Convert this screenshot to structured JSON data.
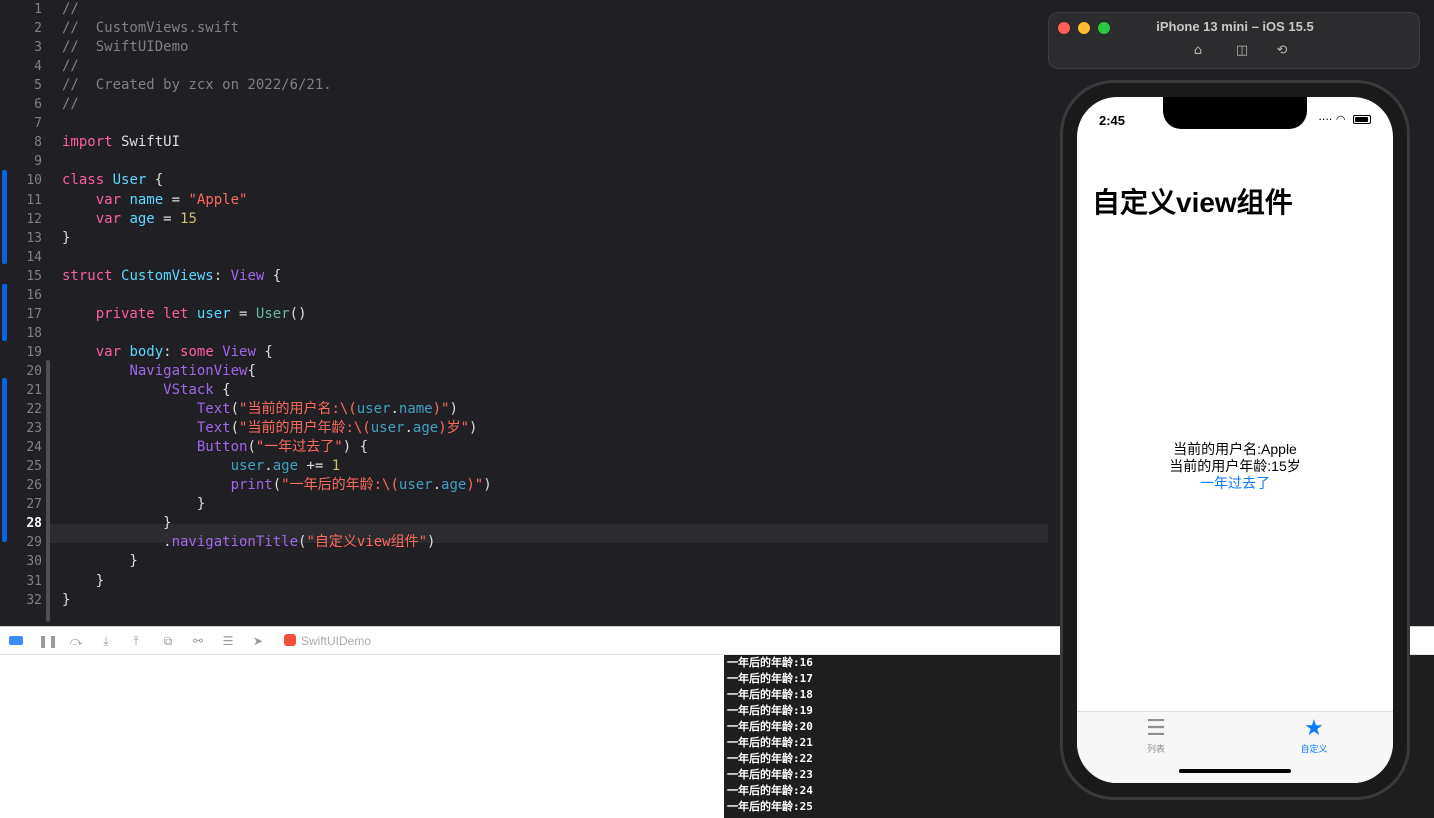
{
  "editor": {
    "lines": [
      {
        "n": "1",
        "tokens": [
          {
            "t": "//",
            "c": "comment"
          }
        ]
      },
      {
        "n": "2",
        "tokens": [
          {
            "t": "//  CustomViews.swift",
            "c": "comment"
          }
        ]
      },
      {
        "n": "3",
        "tokens": [
          {
            "t": "//  SwiftUIDemo",
            "c": "comment"
          }
        ]
      },
      {
        "n": "4",
        "tokens": [
          {
            "t": "//",
            "c": "comment"
          }
        ]
      },
      {
        "n": "5",
        "tokens": [
          {
            "t": "//  Created by zcx on 2022/6/21.",
            "c": "comment"
          }
        ]
      },
      {
        "n": "6",
        "tokens": [
          {
            "t": "//",
            "c": "comment"
          }
        ]
      },
      {
        "n": "7",
        "tokens": []
      },
      {
        "n": "8",
        "tokens": [
          {
            "t": "import",
            "c": "kw"
          },
          {
            "t": " SwiftUI",
            "c": "plain"
          }
        ]
      },
      {
        "n": "9",
        "tokens": []
      },
      {
        "n": "10",
        "tokens": [
          {
            "t": "class",
            "c": "kw"
          },
          {
            "t": " ",
            "c": "plain"
          },
          {
            "t": "User",
            "c": "type"
          },
          {
            "t": " {",
            "c": "plain"
          }
        ]
      },
      {
        "n": "11",
        "tokens": [
          {
            "t": "    ",
            "c": "plain"
          },
          {
            "t": "var",
            "c": "kw"
          },
          {
            "t": " ",
            "c": "plain"
          },
          {
            "t": "name",
            "c": "type"
          },
          {
            "t": " = ",
            "c": "plain"
          },
          {
            "t": "\"Apple\"",
            "c": "str"
          }
        ]
      },
      {
        "n": "12",
        "tokens": [
          {
            "t": "    ",
            "c": "plain"
          },
          {
            "t": "var",
            "c": "kw"
          },
          {
            "t": " ",
            "c": "plain"
          },
          {
            "t": "age",
            "c": "type"
          },
          {
            "t": " = ",
            "c": "plain"
          },
          {
            "t": "15",
            "c": "num"
          }
        ]
      },
      {
        "n": "13",
        "tokens": [
          {
            "t": "}",
            "c": "plain"
          }
        ]
      },
      {
        "n": "14",
        "tokens": []
      },
      {
        "n": "15",
        "tokens": [
          {
            "t": "struct",
            "c": "kw"
          },
          {
            "t": " ",
            "c": "plain"
          },
          {
            "t": "CustomViews",
            "c": "type"
          },
          {
            "t": ": ",
            "c": "plain"
          },
          {
            "t": "View",
            "c": "sys"
          },
          {
            "t": " {",
            "c": "plain"
          }
        ]
      },
      {
        "n": "16",
        "tokens": []
      },
      {
        "n": "17",
        "tokens": [
          {
            "t": "    ",
            "c": "plain"
          },
          {
            "t": "private",
            "c": "kw"
          },
          {
            "t": " ",
            "c": "plain"
          },
          {
            "t": "let",
            "c": "kw"
          },
          {
            "t": " ",
            "c": "plain"
          },
          {
            "t": "user",
            "c": "type"
          },
          {
            "t": " = ",
            "c": "plain"
          },
          {
            "t": "User",
            "c": "fn"
          },
          {
            "t": "()",
            "c": "plain"
          }
        ]
      },
      {
        "n": "18",
        "tokens": []
      },
      {
        "n": "19",
        "tokens": [
          {
            "t": "    ",
            "c": "plain"
          },
          {
            "t": "var",
            "c": "kw"
          },
          {
            "t": " ",
            "c": "plain"
          },
          {
            "t": "body",
            "c": "type"
          },
          {
            "t": ": ",
            "c": "plain"
          },
          {
            "t": "some",
            "c": "kw"
          },
          {
            "t": " ",
            "c": "plain"
          },
          {
            "t": "View",
            "c": "sys"
          },
          {
            "t": " {",
            "c": "plain"
          }
        ]
      },
      {
        "n": "20",
        "tokens": [
          {
            "t": "        ",
            "c": "plain"
          },
          {
            "t": "NavigationView",
            "c": "sys"
          },
          {
            "t": "{",
            "c": "plain"
          }
        ]
      },
      {
        "n": "21",
        "tokens": [
          {
            "t": "            ",
            "c": "plain"
          },
          {
            "t": "VStack",
            "c": "sys"
          },
          {
            "t": " {",
            "c": "plain"
          }
        ]
      },
      {
        "n": "22",
        "tokens": [
          {
            "t": "                ",
            "c": "plain"
          },
          {
            "t": "Text",
            "c": "sys"
          },
          {
            "t": "(",
            "c": "plain"
          },
          {
            "t": "\"当前的用户名:\\(",
            "c": "str"
          },
          {
            "t": "user",
            "c": "prop"
          },
          {
            "t": ".",
            "c": "plain"
          },
          {
            "t": "name",
            "c": "prop"
          },
          {
            "t": ")\"",
            "c": "str"
          },
          {
            "t": ")",
            "c": "plain"
          }
        ]
      },
      {
        "n": "23",
        "tokens": [
          {
            "t": "                ",
            "c": "plain"
          },
          {
            "t": "Text",
            "c": "sys"
          },
          {
            "t": "(",
            "c": "plain"
          },
          {
            "t": "\"当前的用户年龄:\\(",
            "c": "str"
          },
          {
            "t": "user",
            "c": "prop"
          },
          {
            "t": ".",
            "c": "plain"
          },
          {
            "t": "age",
            "c": "prop"
          },
          {
            "t": ")岁\"",
            "c": "str"
          },
          {
            "t": ")",
            "c": "plain"
          }
        ]
      },
      {
        "n": "24",
        "tokens": [
          {
            "t": "                ",
            "c": "plain"
          },
          {
            "t": "Button",
            "c": "sys"
          },
          {
            "t": "(",
            "c": "plain"
          },
          {
            "t": "\"一年过去了\"",
            "c": "str"
          },
          {
            "t": ") {",
            "c": "plain"
          }
        ]
      },
      {
        "n": "25",
        "tokens": [
          {
            "t": "                    ",
            "c": "plain"
          },
          {
            "t": "user",
            "c": "prop"
          },
          {
            "t": ".",
            "c": "plain"
          },
          {
            "t": "age",
            "c": "prop"
          },
          {
            "t": " += ",
            "c": "plain"
          },
          {
            "t": "1",
            "c": "num"
          }
        ]
      },
      {
        "n": "26",
        "tokens": [
          {
            "t": "                    ",
            "c": "plain"
          },
          {
            "t": "print",
            "c": "sys"
          },
          {
            "t": "(",
            "c": "plain"
          },
          {
            "t": "\"一年后的年龄:\\(",
            "c": "str"
          },
          {
            "t": "user",
            "c": "prop"
          },
          {
            "t": ".",
            "c": "plain"
          },
          {
            "t": "age",
            "c": "prop"
          },
          {
            "t": ")\"",
            "c": "str"
          },
          {
            "t": ")",
            "c": "plain"
          }
        ]
      },
      {
        "n": "27",
        "tokens": [
          {
            "t": "                }",
            "c": "plain"
          }
        ]
      },
      {
        "n": "28",
        "tokens": [
          {
            "t": "            }",
            "c": "plain"
          }
        ]
      },
      {
        "n": "29",
        "tokens": [
          {
            "t": "            .",
            "c": "plain"
          },
          {
            "t": "navigationTitle",
            "c": "sys"
          },
          {
            "t": "(",
            "c": "plain"
          },
          {
            "t": "\"自定义view组件\"",
            "c": "str"
          },
          {
            "t": ")",
            "c": "plain"
          }
        ]
      },
      {
        "n": "30",
        "tokens": [
          {
            "t": "        }",
            "c": "plain"
          }
        ]
      },
      {
        "n": "31",
        "tokens": [
          {
            "t": "    }",
            "c": "plain"
          }
        ]
      },
      {
        "n": "32",
        "tokens": [
          {
            "t": "}",
            "c": "plain"
          }
        ]
      }
    ],
    "current_line": "28"
  },
  "debug_bar": {
    "scheme_label": "SwiftUIDemo",
    "icons": [
      "breakpoint-toggle-icon",
      "pause-icon",
      "step-over-icon",
      "step-into-icon",
      "step-out-icon",
      "view-hierarchy-icon",
      "memory-graph-icon",
      "environment-overrides-icon",
      "location-icon"
    ]
  },
  "console": {
    "lines": [
      "一年后的年龄:16",
      "一年后的年龄:17",
      "一年后的年龄:18",
      "一年后的年龄:19",
      "一年后的年龄:20",
      "一年后的年龄:21",
      "一年后的年龄:22",
      "一年后的年龄:23",
      "一年后的年龄:24",
      "一年后的年龄:25"
    ]
  },
  "simulator": {
    "title": "iPhone 13 mini – iOS 15.5",
    "toolbar_icons": [
      "home-icon",
      "screenshot-icon",
      "rotate-icon"
    ],
    "status_time": "2:45",
    "nav_title": "自定义view组件",
    "user_name_text": "当前的用户名:Apple",
    "user_age_text": "当前的用户年龄:15岁",
    "button_label": "一年过去了",
    "tabs": [
      {
        "label": "列表",
        "icon": "list-icon",
        "selected": false
      },
      {
        "label": "自定义",
        "icon": "star-icon",
        "selected": true
      }
    ]
  },
  "colors": {
    "editor_bg": "#1f1f24",
    "keyword": "#fc5fa3",
    "type": "#5dd8ff",
    "string": "#fc6a5d",
    "number": "#d0bf69",
    "accent_blue": "#0a7aff",
    "change_bar": "#0a62e0"
  }
}
